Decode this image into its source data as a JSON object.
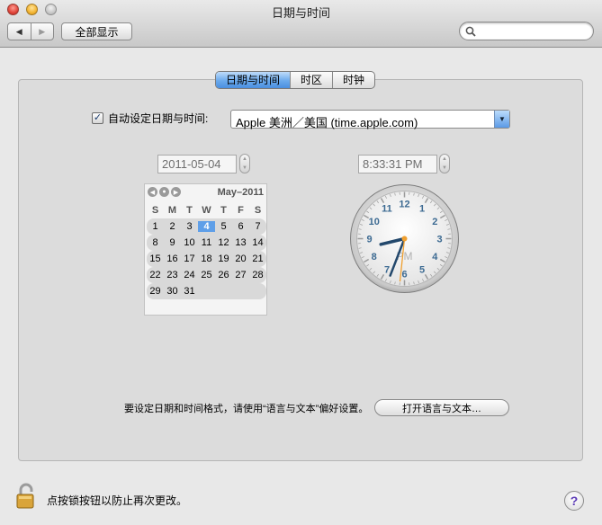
{
  "window": {
    "title": "日期与时间"
  },
  "toolbar": {
    "back_icon": "back-arrow-icon",
    "forward_icon": "forward-arrow-icon",
    "show_all_label": "全部显示",
    "search_value": ""
  },
  "tabs": [
    {
      "label": "日期与时间",
      "active": true
    },
    {
      "label": "时区",
      "active": false
    },
    {
      "label": "时钟",
      "active": false
    }
  ],
  "auto": {
    "checked": true,
    "label": "自动设定日期与时间:",
    "server": "Apple 美洲／美国 (time.apple.com)"
  },
  "date": {
    "value": "2011-05-04"
  },
  "time": {
    "value": "8:33:31 PM"
  },
  "calendar": {
    "month_label": "May–2011",
    "weekdays": [
      "S",
      "M",
      "T",
      "W",
      "T",
      "F",
      "S"
    ],
    "weeks": [
      [
        "",
        "1",
        "2",
        "3",
        "4",
        "5",
        "6",
        "7"
      ],
      [
        "",
        "8",
        "9",
        "10",
        "11",
        "12",
        "13",
        "14"
      ],
      [
        "",
        "15",
        "16",
        "17",
        "18",
        "19",
        "20",
        "21"
      ],
      [
        "",
        "22",
        "23",
        "24",
        "25",
        "26",
        "27",
        "28"
      ],
      [
        "",
        "29",
        "30",
        "31",
        "",
        "",
        "",
        ""
      ]
    ],
    "selected_day": "4"
  },
  "clock": {
    "numbers": [
      "12",
      "1",
      "2",
      "3",
      "4",
      "5",
      "6",
      "7",
      "8",
      "9",
      "10",
      "11"
    ],
    "ampm": "PM",
    "hour": 8,
    "minute": 33,
    "second": 31
  },
  "format": {
    "note": "要设定日期和时间格式，请使用“语言与文本”偏好设置。",
    "button_label": "打开语言与文本…"
  },
  "footer": {
    "lock_label": "点按锁按钮以防止再次更改。",
    "help_label": "?"
  },
  "colors": {
    "accent": "#5f9fe8",
    "clock_numbers": "#3c6a92",
    "second_hand": "#f0a030"
  }
}
